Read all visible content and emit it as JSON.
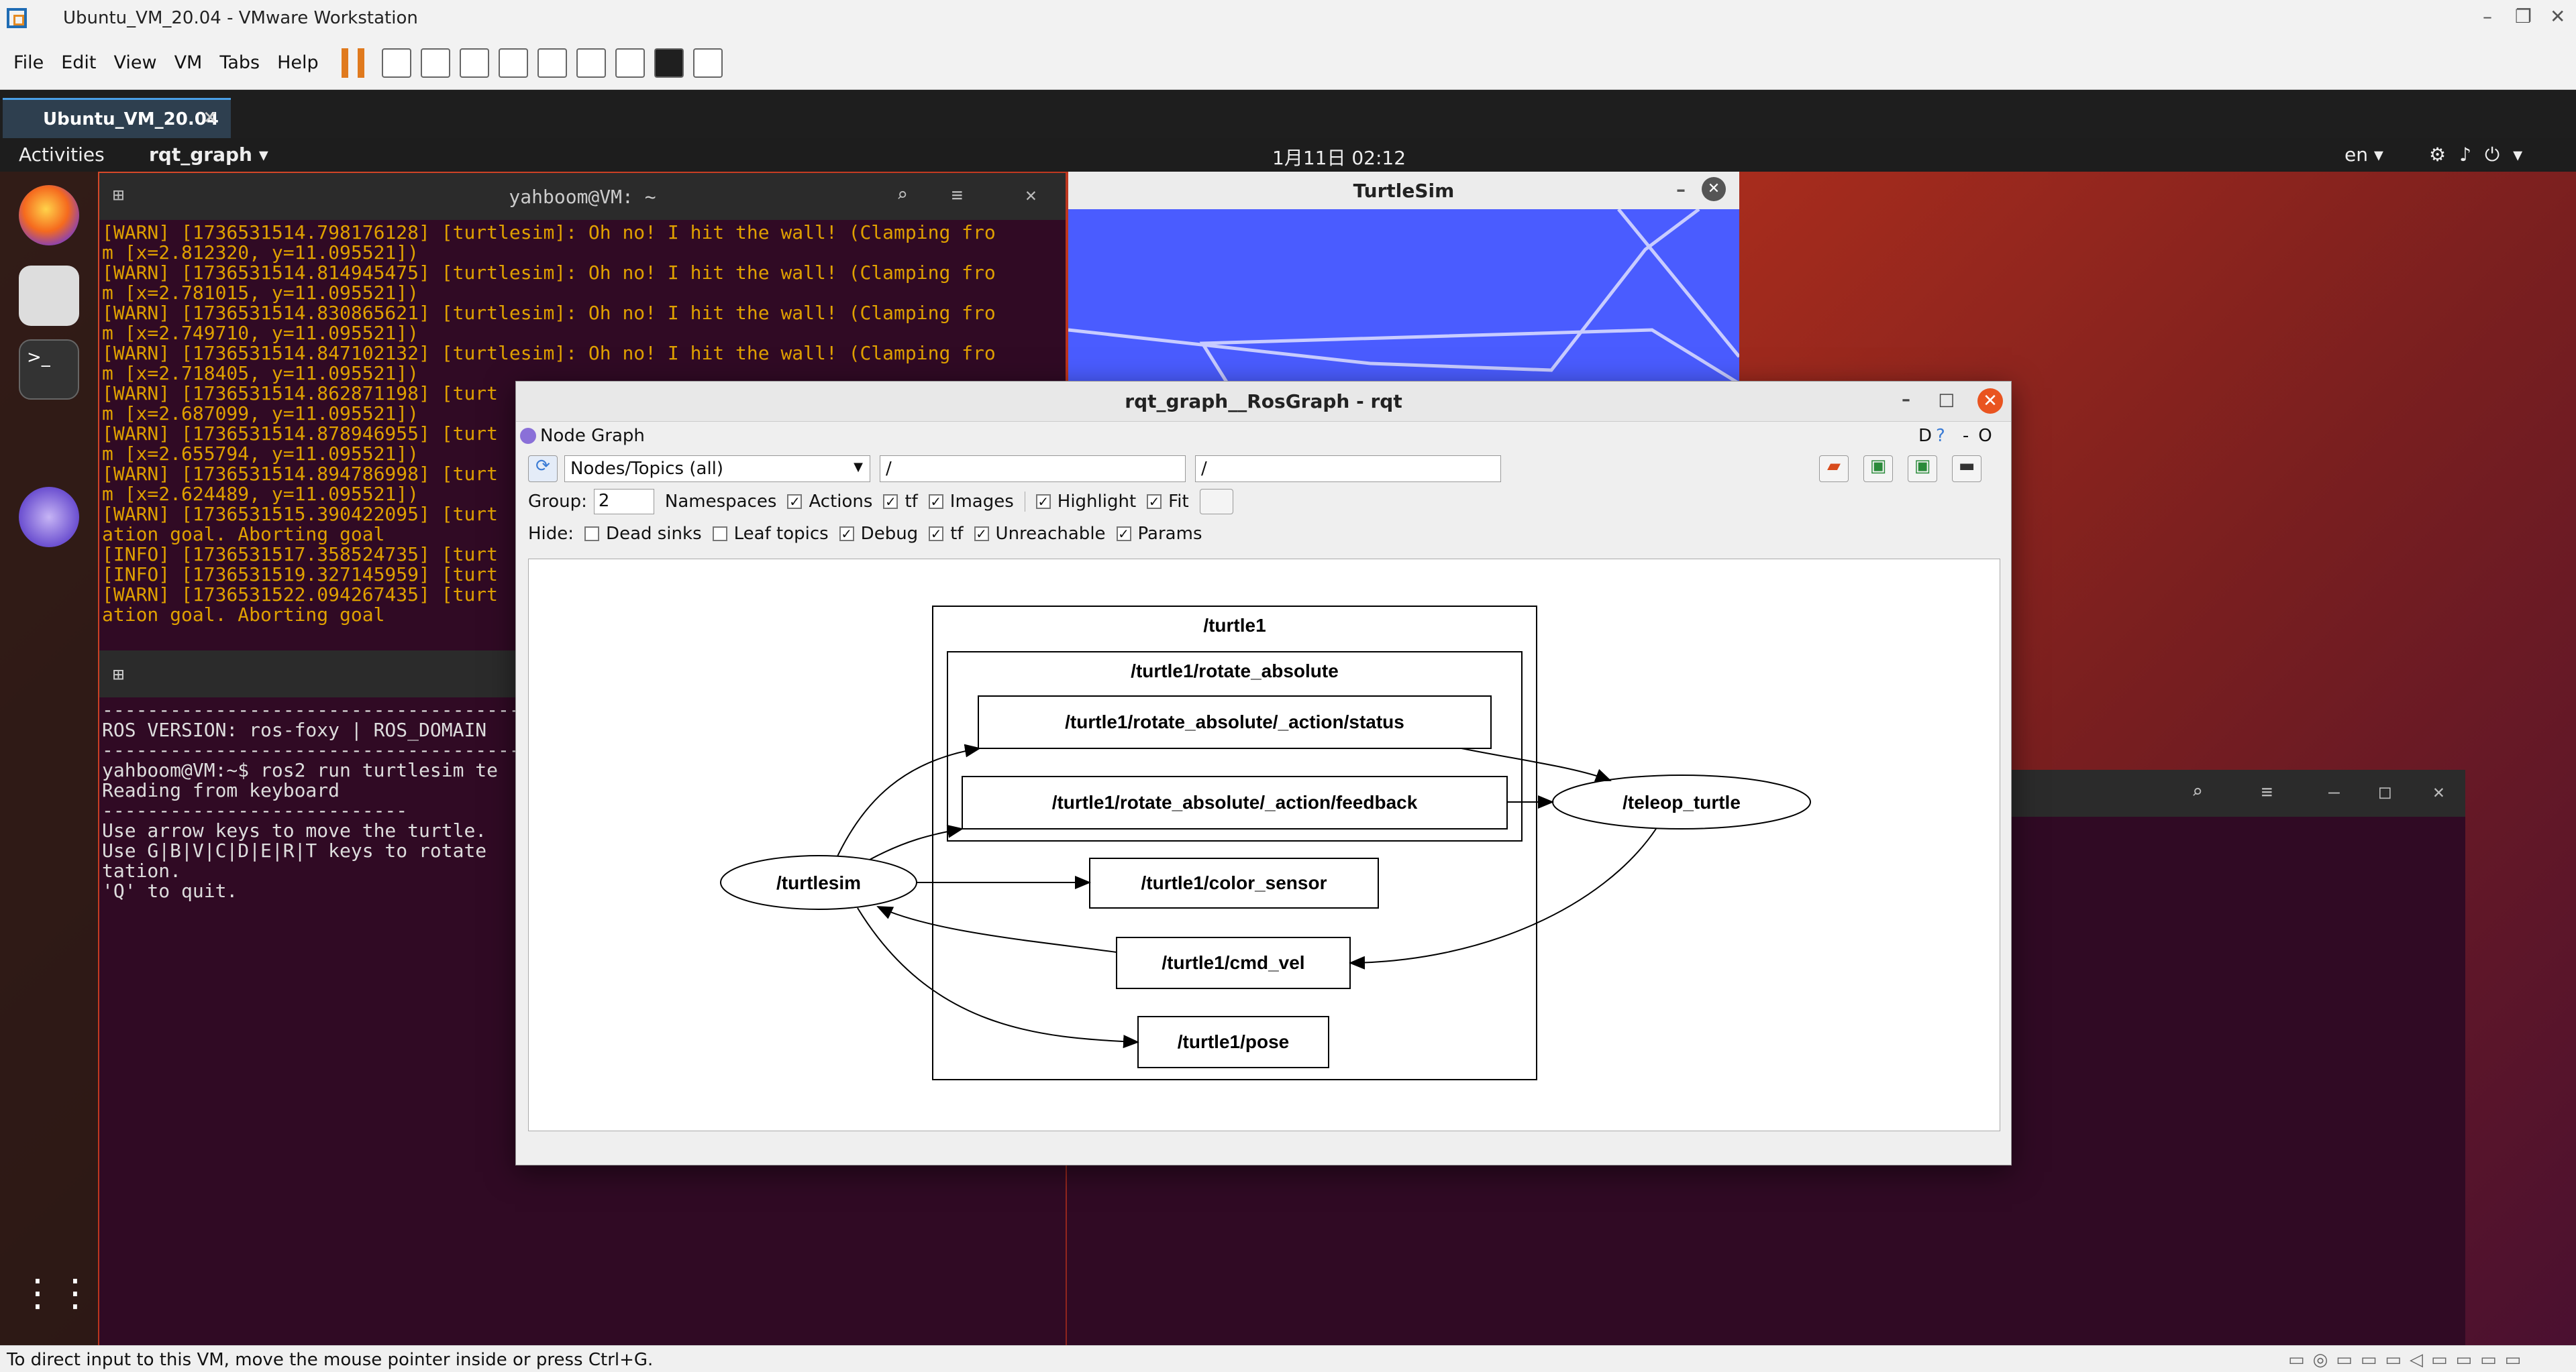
{
  "vmware": {
    "title": "Ubuntu_VM_20.04 - VMware Workstation",
    "menu": [
      "File",
      "Edit",
      "View",
      "VM",
      "Tabs",
      "Help"
    ],
    "tab": "Ubuntu_VM_20.04",
    "status": "To direct input to this VM, move the mouse pointer inside or press Ctrl+G."
  },
  "ubuntu": {
    "activities": "Activities",
    "app_menu": "rqt_graph ▾",
    "clock": "1月11日  02:12",
    "lang": "en ▾"
  },
  "terminal1": {
    "title": "yahboom@VM: ~",
    "lines": "[WARN] [1736531514.798176128] [turtlesim]: Oh no! I hit the wall! (Clamping fro\nm [x=2.812320, y=11.095521])\n[WARN] [1736531514.814945475] [turtlesim]: Oh no! I hit the wall! (Clamping fro\nm [x=2.781015, y=11.095521])\n[WARN] [1736531514.830865621] [turtlesim]: Oh no! I hit the wall! (Clamping fro\nm [x=2.749710, y=11.095521])\n[WARN] [1736531514.847102132] [turtlesim]: Oh no! I hit the wall! (Clamping fro\nm [x=2.718405, y=11.095521])\n[WARN] [1736531514.862871198] [turt\nm [x=2.687099, y=11.095521])\n[WARN] [1736531514.878946955] [turt\nm [x=2.655794, y=11.095521])\n[WARN] [1736531514.894786998] [turt\nm [x=2.624489, y=11.095521])\n[WARN] [1736531515.390422095] [turt\nation goal. Aborting goal\n[INFO] [1736531517.358524735] [turt\n[INFO] [1736531519.327145959] [turt\n[WARN] [1736531522.094267435] [turt\nation goal. Aborting goal"
  },
  "terminal2": {
    "lines": "------------------------------------------\nROS VERSION: ros-foxy | ROS_DOMAIN\n------------------------------------------\nyahboom@VM:~$ ros2 run turtlesim te\nReading from keyboard\n---------------------------\nUse arrow keys to move the turtle.\nUse G|B|V|C|D|E|R|T keys to rotate\ntation.\n'Q' to quit."
  },
  "turtlesim": {
    "title": "TurtleSim",
    "bg_color": "#4a5cff"
  },
  "rqt": {
    "title": "rqt_graph__RosGraph - rqt",
    "plugin": "Node Graph",
    "mode": "Nodes/Topics (all)",
    "ns_filter": "/",
    "topic_filter": "/",
    "group_label": "Group:",
    "group_value": "2",
    "row1": [
      "Namespaces",
      "Actions",
      "tf",
      "Images",
      "Highlight",
      "Fit"
    ],
    "hide_label": "Hide:",
    "row2": [
      "Dead sinks",
      "Leaf topics",
      "Debug",
      "tf",
      "Unreachable",
      "Params"
    ],
    "graph": {
      "outer": "/turtle1",
      "inner": "/turtle1/rotate_absolute",
      "status": "/turtle1/rotate_absolute/_action/status",
      "feedback": "/turtle1/rotate_absolute/_action/feedback",
      "color": "/turtle1/color_sensor",
      "cmd": "/turtle1/cmd_vel",
      "pose": "/turtle1/pose",
      "turtlesim": "/turtlesim",
      "teleop": "/teleop_turtle"
    }
  }
}
